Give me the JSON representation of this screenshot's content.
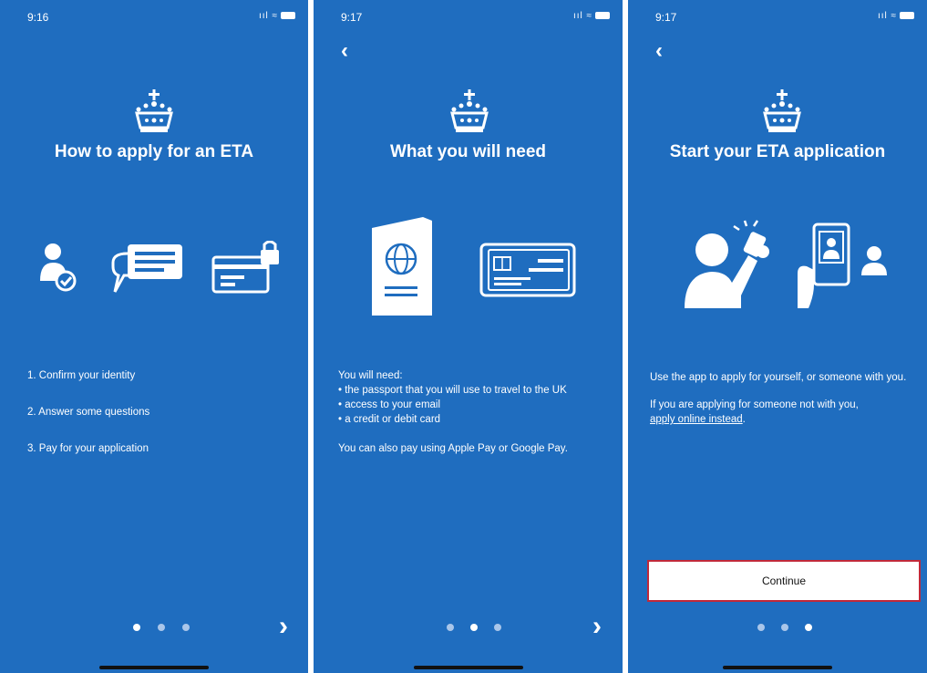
{
  "colors": {
    "background": "#1f6dbf",
    "dot_inactive": "#a9c6ea",
    "button_border": "#c0293a"
  },
  "screens": [
    {
      "time": "9:16",
      "status_icons": "signal-wifi-battery",
      "title": "How to apply for an ETA",
      "icons": [
        "person-check-icon",
        "chat-bubble-icon",
        "card-lock-icon"
      ],
      "steps": [
        "1. Confirm your identity",
        "2. Answer some questions",
        "3. Pay for your application"
      ],
      "active_dot": 0
    },
    {
      "time": "9:17",
      "status_icons": "signal-wifi-battery",
      "title": "What you will need",
      "icons": [
        "passport-icon",
        "credit-card-icon"
      ],
      "intro": "You will need:",
      "items": [
        "• the passport that you will use to travel to the UK",
        "• access to your email",
        "• a credit or debit card"
      ],
      "note": "You can also pay using Apple Pay or Google Pay.",
      "active_dot": 1
    },
    {
      "time": "9:17",
      "status_icons": "signal-wifi-battery",
      "title": "Start your ETA application",
      "icons": [
        "selfie-icon",
        "phone-person-icon"
      ],
      "para1": "Use the app to apply for yourself, or someone with you.",
      "para2_prefix": "If you are applying for someone not with you,",
      "para2_link": "apply online instead",
      "para2_suffix": ".",
      "button_label": "Continue",
      "active_dot": 2
    }
  ]
}
